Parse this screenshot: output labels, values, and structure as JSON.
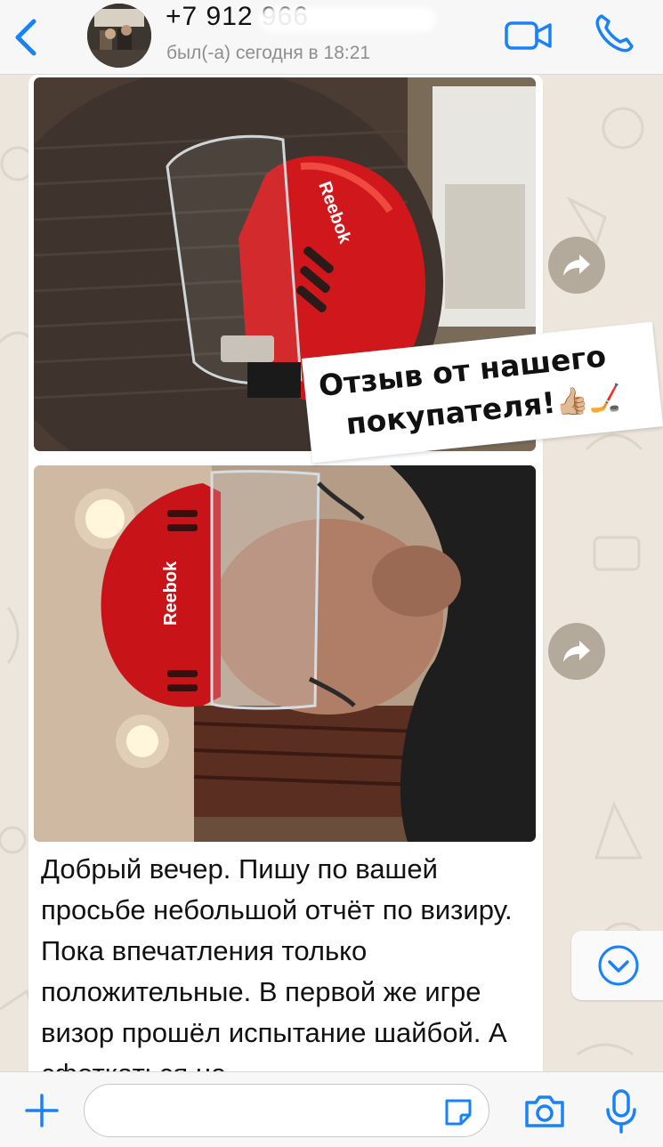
{
  "header": {
    "contact_name": "+7 912 966",
    "status": "был(-а) сегодня в 18:21"
  },
  "message": {
    "sticker_line1": "Отзыв от нашего",
    "sticker_line2": "покупателя!",
    "sticker_emoji": "👍🏼🏒",
    "helmet_brand": "Reebok",
    "text": "Добрый вечер. Пишу по вашей просьбе небольшой отчёт по визиру. Пока впечатления только положительные. В первой же игре визор прошёл испытание шайбой. А сфоткаться не"
  },
  "input": {
    "value": "",
    "placeholder": ""
  },
  "icons": {
    "back": "chevron-left-icon",
    "video": "video-camera-icon",
    "call": "phone-icon",
    "forward": "forward-arrow-icon",
    "scroll_down": "chevron-down-circle-icon",
    "plus": "plus-icon",
    "sticker": "sticker-icon",
    "camera": "camera-icon",
    "mic": "microphone-icon"
  },
  "colors": {
    "accent": "#1a82f7",
    "helmet_red": "#d0181c",
    "bubble": "#ffffff",
    "wallpaper": "#ece6dc"
  }
}
